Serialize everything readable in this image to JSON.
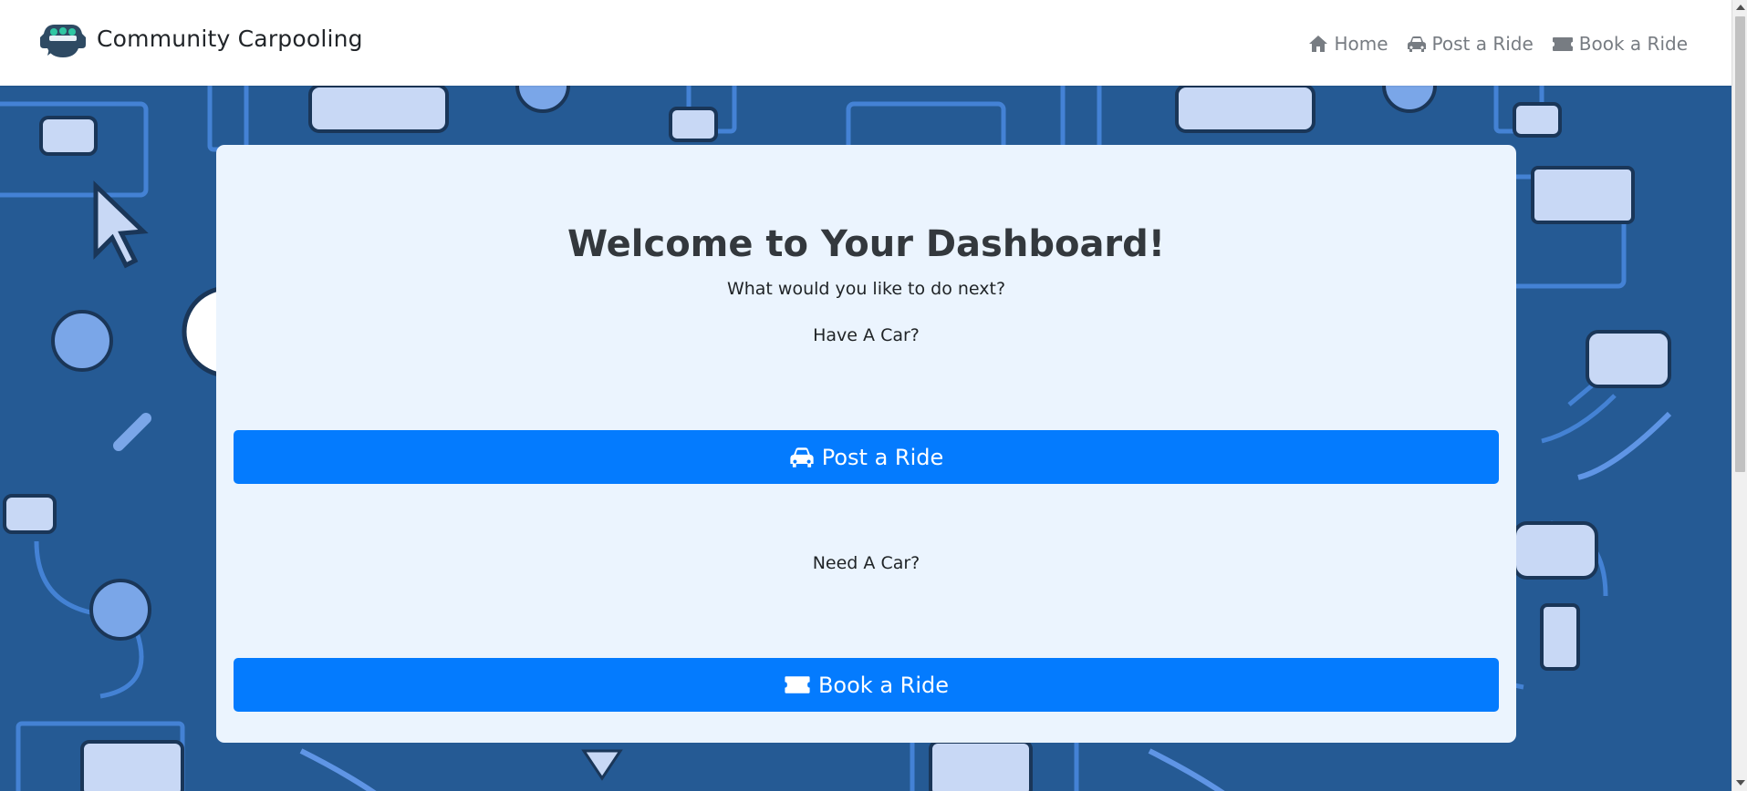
{
  "brand": {
    "name": "Community Carpooling",
    "logo_icon": "carpool-logo-icon"
  },
  "nav": {
    "items": [
      {
        "label": "Home",
        "icon": "home-icon"
      },
      {
        "label": "Post a Ride",
        "icon": "car-icon"
      },
      {
        "label": "Book a Ride",
        "icon": "ticket-icon"
      }
    ]
  },
  "dashboard": {
    "title": "Welcome to Your Dashboard!",
    "subtitle": "What would you like to do next?",
    "have_car_prompt": "Have A Car?",
    "post_button_label": "Post a Ride",
    "need_car_prompt": "Need A Car?",
    "book_button_label": "Book a Ride"
  },
  "colors": {
    "primary_button": "#047bfe",
    "card_background": "#ebf4fe",
    "page_background": "#255a94",
    "navbar_background": "#ffffff",
    "nav_text": "#777c82"
  }
}
